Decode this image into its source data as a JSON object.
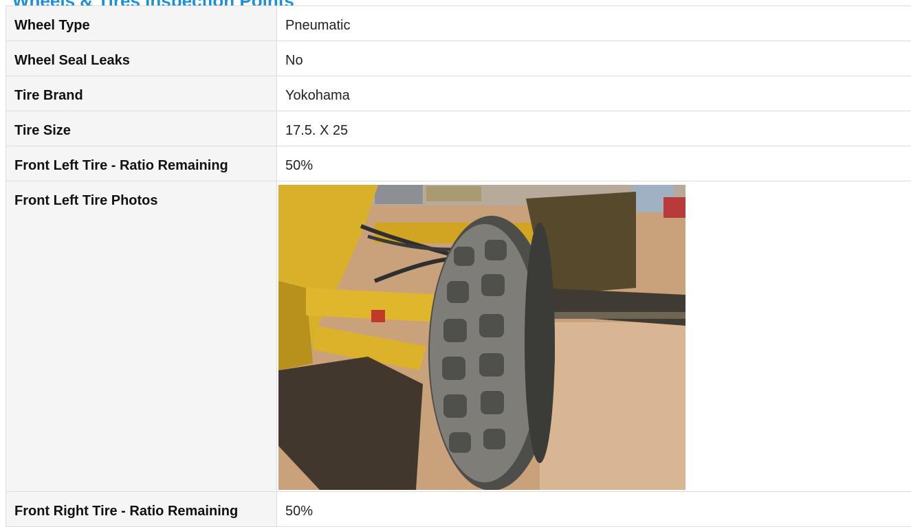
{
  "section": {
    "title": "Wheels & Tires Inspection Points"
  },
  "rows": [
    {
      "label": "Wheel Type",
      "value": "Pneumatic"
    },
    {
      "label": "Wheel Seal Leaks",
      "value": "No"
    },
    {
      "label": "Tire Brand",
      "value": "Yokohama"
    },
    {
      "label": "Tire Size",
      "value": "17.5. X 25"
    },
    {
      "label": "Front Left Tire - Ratio Remaining",
      "value": "50%"
    }
  ],
  "photo_row": {
    "label": "Front Left Tire Photos",
    "photo_subject": "front-left-tire-photo"
  },
  "after_photo_rows": [
    {
      "label": "Front Right Tire - Ratio Remaining",
      "value": "50%"
    }
  ],
  "colors": {
    "heading": "#1e90d8",
    "label_background": "#f5f5f5",
    "border": "#dcdcdc",
    "machine_yellow": "#d8b02a",
    "dirt": "#c9a27c"
  }
}
